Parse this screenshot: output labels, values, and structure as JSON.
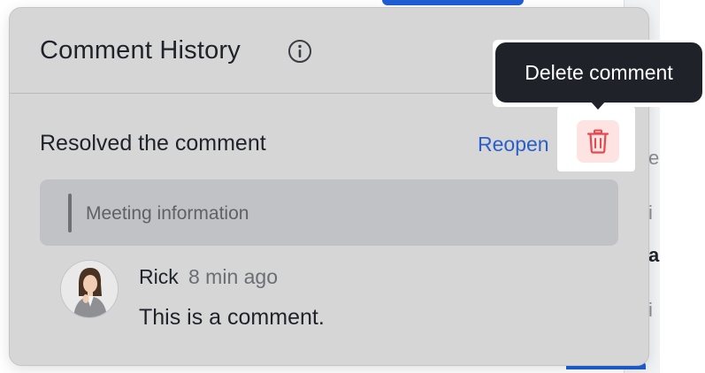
{
  "panel": {
    "title": "Comment History",
    "info_icon": "info-circle-icon"
  },
  "history_entry": {
    "action_text": "Resolved the comment",
    "reopen_label": "Reopen",
    "delete_icon": "trash-icon",
    "quote": "Meeting information"
  },
  "comment": {
    "author": "Rick",
    "time": "8 min ago",
    "body": "This is a comment.",
    "avatar_icon": "user-avatar"
  },
  "tooltip": {
    "label": "Delete comment"
  },
  "background": {
    "chars": [
      "e",
      "i",
      "a",
      "i"
    ]
  },
  "colors": {
    "accent": "#2a5fc9",
    "danger": "#e5484d",
    "tooltip_bg": "#1f2329"
  }
}
